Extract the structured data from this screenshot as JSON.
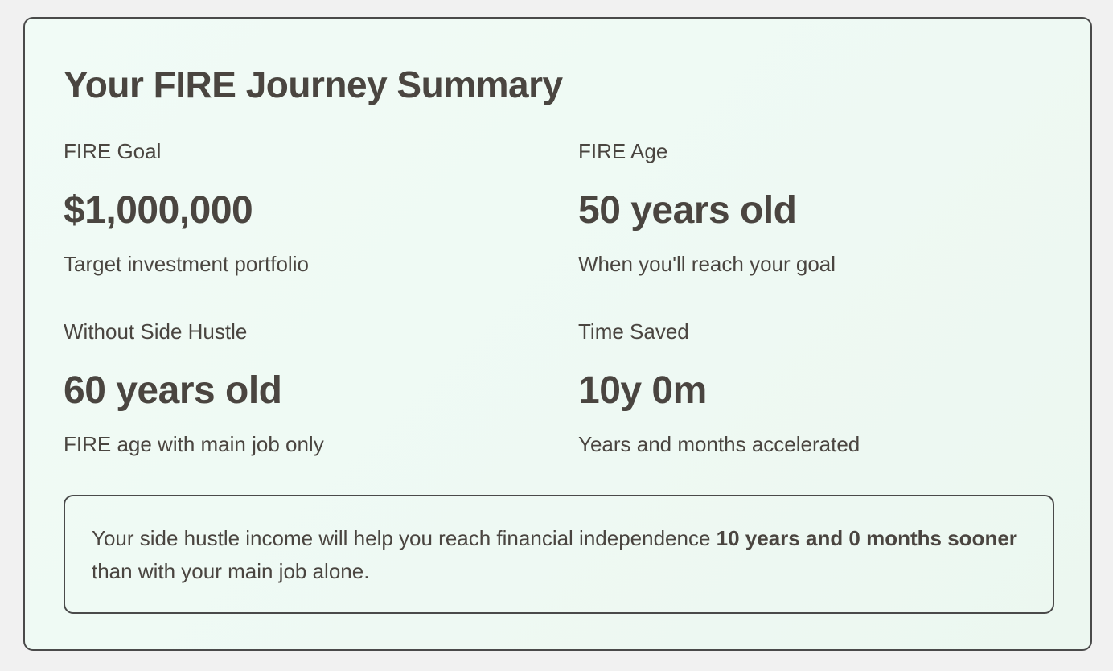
{
  "summary": {
    "title": "Your FIRE Journey Summary",
    "stats": [
      {
        "label": "FIRE Goal",
        "value": "$1,000,000",
        "description": "Target investment portfolio"
      },
      {
        "label": "FIRE Age",
        "value": "50 years old",
        "description": "When you'll reach your goal"
      },
      {
        "label": "Without Side Hustle",
        "value": "60 years old",
        "description": "FIRE age with main job only"
      },
      {
        "label": "Time Saved",
        "value": "10y 0m",
        "description": "Years and months accelerated"
      }
    ],
    "note": {
      "prefix": "Your side hustle income will help you reach financial independence ",
      "highlight": "10 years and 0 months sooner",
      "suffix": " than with your main job alone."
    }
  },
  "colors": {
    "text": "#4a4540",
    "card_background": "#eef9f3",
    "border": "#4a4a4a",
    "page_background": "#f1f1f1"
  }
}
